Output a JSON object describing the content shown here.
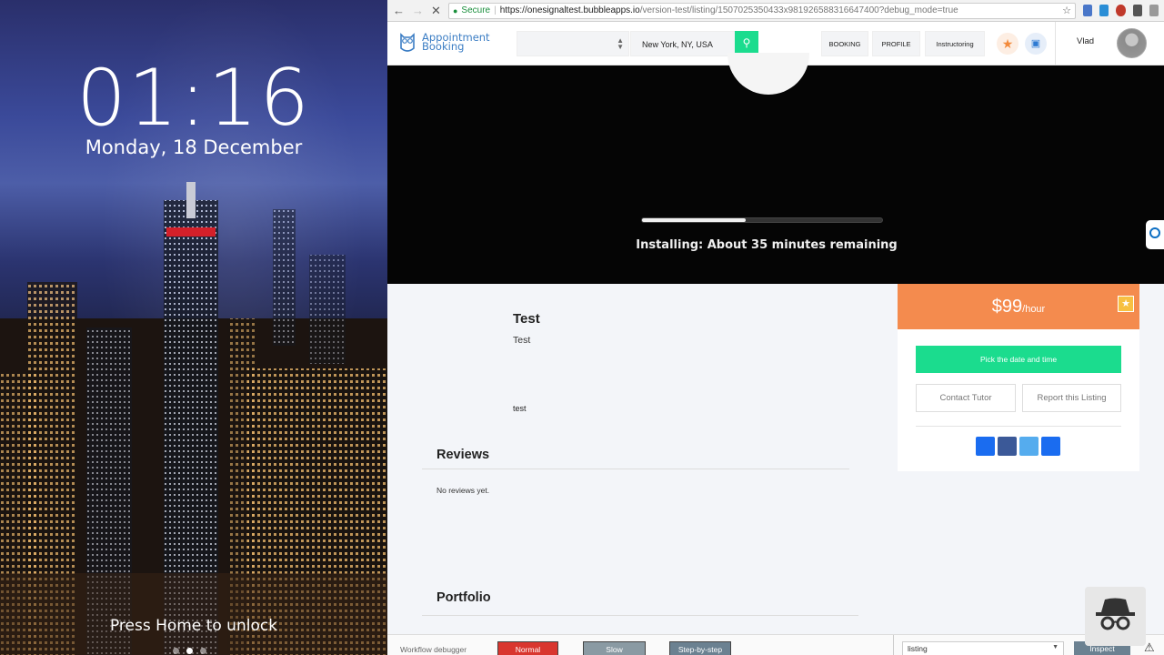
{
  "lockscreen": {
    "time": "01:16",
    "date": "Monday, 18 December",
    "unlock_hint": "Press Home to unlock"
  },
  "browser": {
    "secure_label": "Secure",
    "url_host": "https://onesignaltest.bubbleapps.io",
    "url_path": "/version-test/listing/1507025350433x981926588316647400?debug_mode=true",
    "icons": [
      "back-icon",
      "forward-icon",
      "stop-icon",
      "lock-icon",
      "bookmark-star-icon"
    ]
  },
  "header": {
    "logo_line1": "Appointment",
    "logo_line2": "Booking",
    "location_value": "New York, NY, USA",
    "nav": {
      "booking": "BOOKING",
      "profile": "PROFILE",
      "instructoring": "Instructoring"
    },
    "user_name": "Vlad"
  },
  "hero": {
    "install_text": "Installing: About 35 minutes remaining",
    "progress": 0.43
  },
  "listing": {
    "title": "Test",
    "subtitle": "Test",
    "description": "test",
    "reviews_title": "Reviews",
    "no_reviews": "No reviews yet.",
    "portfolio_title": "Portfolio"
  },
  "price_card": {
    "amount": "$99",
    "unit": "/hour",
    "pick_label": "Pick the date and time",
    "contact_label": "Contact Tutor",
    "report_label": "Report this Listing",
    "share_colors": [
      "#1a6cf0",
      "#3b5998",
      "#55acee",
      "#1a6cf0"
    ]
  },
  "debugger": {
    "label": "Workflow debugger",
    "normal": "Normal",
    "slow": "Slow",
    "step": "Step-by-step",
    "select_value": "listing",
    "inspect": "Inspect"
  },
  "colors": {
    "accent_green": "#1bdc8e",
    "price_orange": "#f48b4e",
    "brand_blue": "#3b7dc4",
    "debug_red": "#d9362f"
  }
}
